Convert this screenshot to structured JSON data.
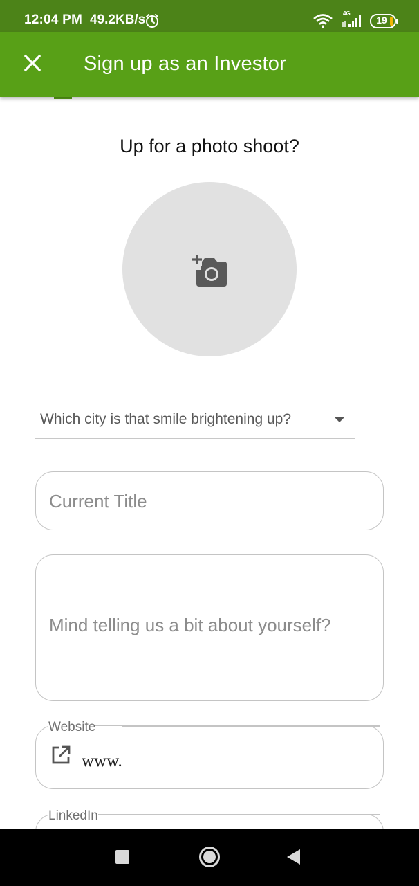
{
  "status_bar": {
    "time": "12:04 PM",
    "network_speed": "49.2KB/s",
    "network_type": "4G",
    "battery_level": "19",
    "color": "#4c8318"
  },
  "app_bar": {
    "close_icon": "close-icon",
    "title": "Sign up as an Investor",
    "color": "#58a017"
  },
  "photo": {
    "heading": "Up for a photo shoot?",
    "icon": "add-a-photo-icon"
  },
  "city_select": {
    "placeholder": "Which city is that smile brightening up?",
    "icon": "dropdown-caret-icon"
  },
  "current_title": {
    "placeholder": "Current Title",
    "value": ""
  },
  "about": {
    "placeholder": "Mind telling us a bit about yourself?",
    "value": ""
  },
  "website": {
    "label": "Website",
    "value": "www.",
    "icon": "open-in-new-icon"
  },
  "linkedin": {
    "label": "LinkedIn"
  },
  "nav_bar": {
    "recents_icon": "square-icon",
    "home_icon": "circle-icon",
    "back_icon": "triangle-back-icon"
  }
}
